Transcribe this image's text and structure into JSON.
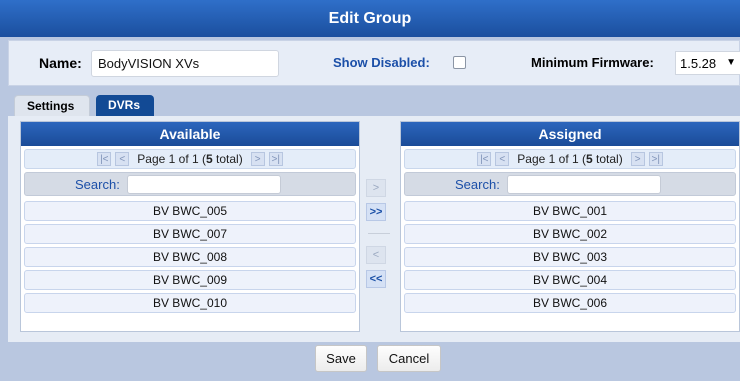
{
  "dialog": {
    "title": "Edit Group",
    "name_label": "Name:",
    "name_value": "BodyVISION XVs",
    "show_disabled_label": "Show Disabled:",
    "show_disabled_checked": false,
    "firmware_label": "Minimum Firmware:",
    "firmware_value": "1.5.28"
  },
  "tabs": [
    {
      "label": "Settings",
      "active": false
    },
    {
      "label": "DVRs",
      "active": true
    }
  ],
  "available": {
    "header": "Available",
    "page_text": "Page 1 of 1 (",
    "total": "5",
    "total_suffix": " total)",
    "search_label": "Search:",
    "search_value": "",
    "items": [
      "BV BWC_005",
      "BV BWC_007",
      "BV BWC_008",
      "BV BWC_009",
      "BV BWC_010"
    ]
  },
  "assigned": {
    "header": "Assigned",
    "page_text": "Page 1 of 1 (",
    "total": "5",
    "total_suffix": " total)",
    "search_label": "Search:",
    "search_value": "",
    "items": [
      "BV BWC_001",
      "BV BWC_002",
      "BV BWC_003",
      "BV BWC_004",
      "BV BWC_006"
    ]
  },
  "movers": {
    "right": ">",
    "all_right": ">>",
    "left": "<",
    "all_left": "<<"
  },
  "pager_icons": {
    "first": "|<",
    "prev": "<",
    "next": ">",
    "last": ">|"
  },
  "footer": {
    "save_label": "Save",
    "cancel_label": "Cancel"
  },
  "colors": {
    "titlebar": "#1f58b0",
    "panel_header": "#1f58b0",
    "accent_text": "#1b4fa8"
  }
}
